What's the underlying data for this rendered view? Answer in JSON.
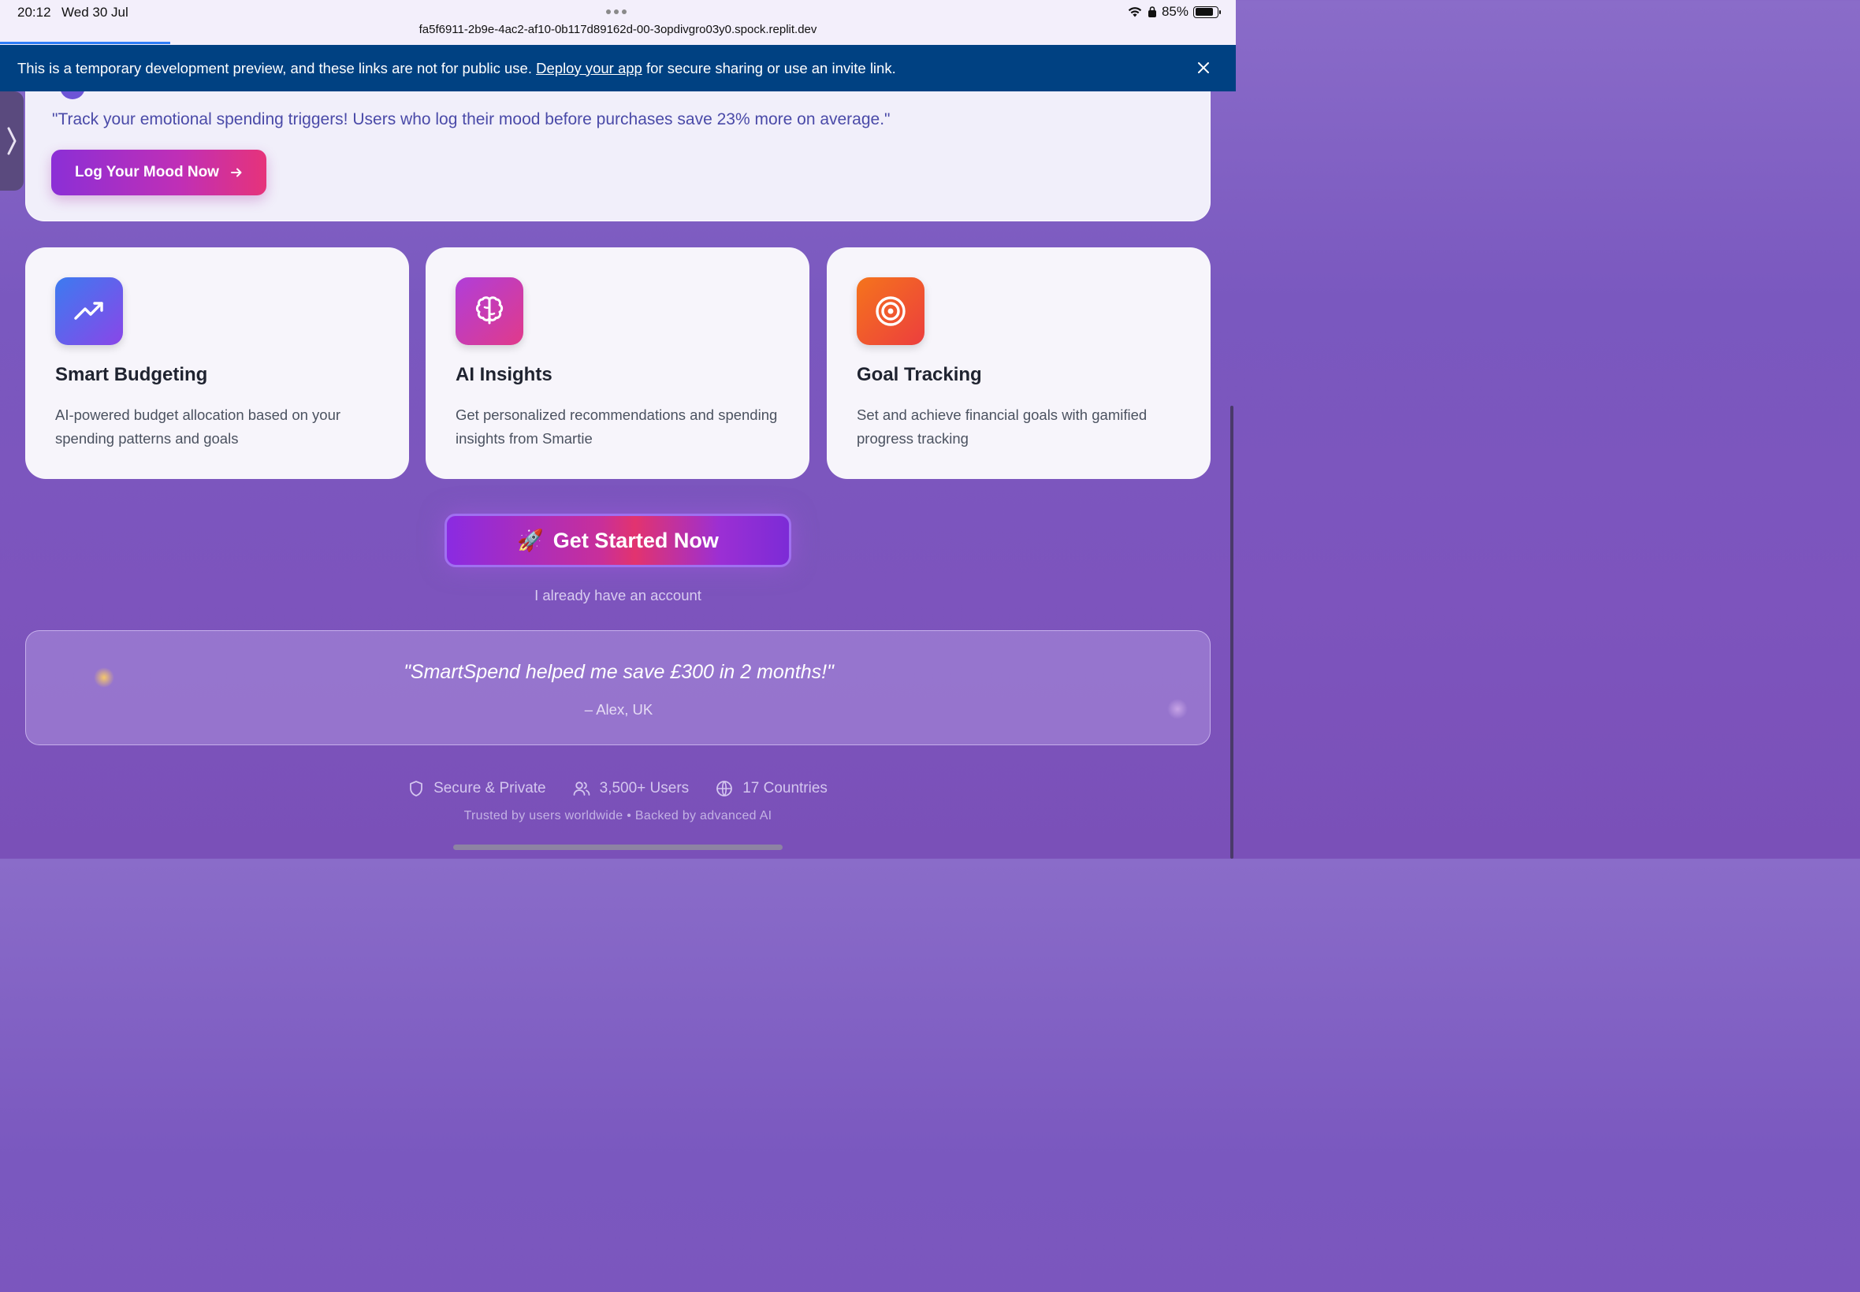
{
  "status_bar": {
    "time": "20:12",
    "date": "Wed 30 Jul",
    "url": "fa5f6911-2b9e-4ac2-af10-0b117d89162d-00-3opdivgro03y0.spock.replit.dev",
    "battery": "85%",
    "battery_level": 0.85
  },
  "banner": {
    "text_before": "This is a temporary development preview, and these links are not for public use.",
    "link_label": "Deploy your app",
    "text_after": "for secure sharing or use an invite link."
  },
  "mood": {
    "quote": "\"Track your emotional spending triggers! Users who log their mood before purchases save 23% more on average.\"",
    "button_label": "Log Your Mood Now"
  },
  "features": [
    {
      "title": "Smart Budgeting",
      "description": "AI-powered budget allocation based on your spending patterns and goals",
      "icon": "trending-up-icon"
    },
    {
      "title": "AI Insights",
      "description": "Get personalized recommendations and spending insights from Smartie",
      "icon": "brain-icon"
    },
    {
      "title": "Goal Tracking",
      "description": "Set and achieve financial goals with gamified progress tracking",
      "icon": "target-icon"
    }
  ],
  "cta": {
    "emoji": "🚀",
    "label": "Get Started Now",
    "secondary_link": "I already have an account"
  },
  "testimonial": {
    "quote": "\"SmartSpend helped me save £300 in 2 months!\"",
    "author": "– Alex, UK"
  },
  "stats": [
    {
      "icon": "shield-icon",
      "label": "Secure & Private"
    },
    {
      "icon": "users-icon",
      "label": "3,500+ Users"
    },
    {
      "icon": "globe-icon",
      "label": "17 Countries"
    }
  ],
  "footer_note": "Trusted by users worldwide • Backed by advanced AI",
  "colors": {
    "banner": "#004182",
    "accent_purple": "#8b2fd6",
    "accent_pink": "#e6337a"
  }
}
